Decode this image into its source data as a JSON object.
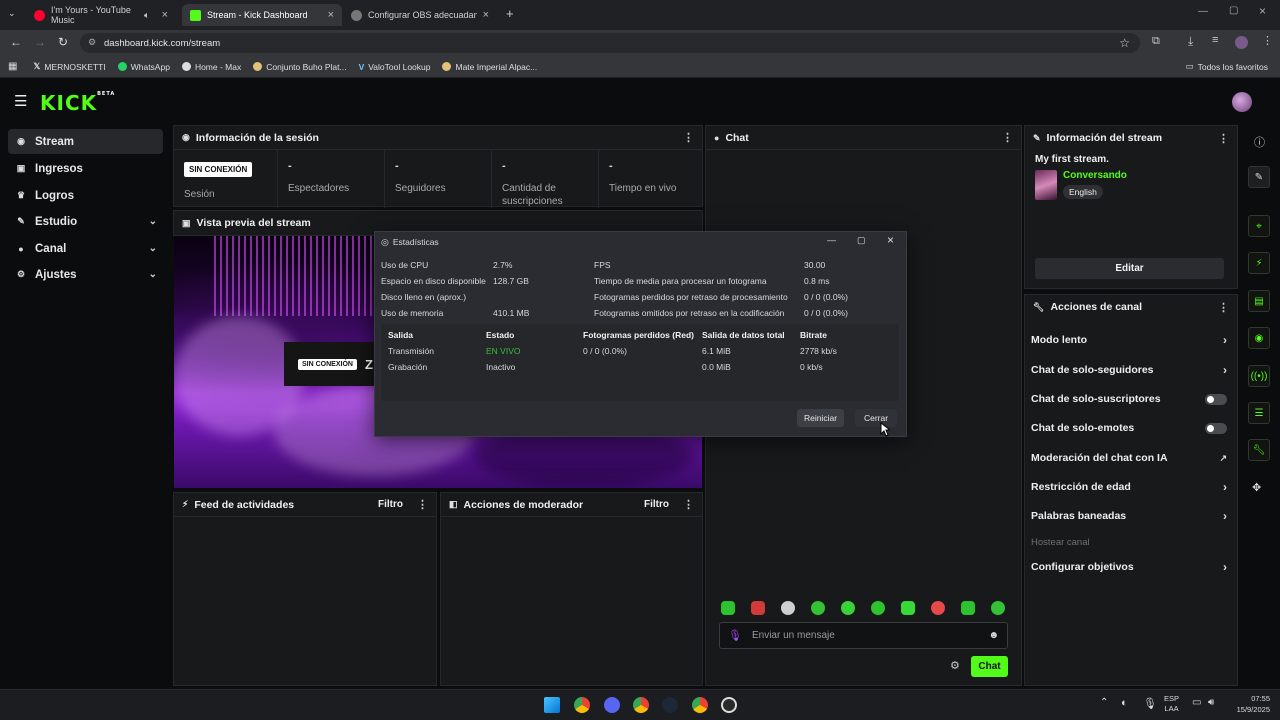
{
  "browser": {
    "tabs": [
      {
        "title": "I'm Yours - YouTube Music",
        "active": false,
        "color": "#ff0033"
      },
      {
        "title": "Stream - Kick Dashboard",
        "active": true,
        "color": "#53fc18"
      },
      {
        "title": "Configurar OBS adecuadament",
        "active": false,
        "color": "#888888"
      }
    ],
    "new_tab_icon": "plus-icon",
    "url": "dashboard.kick.com/stream",
    "bookmarks": [
      "MERNOSKETTI",
      "WhatsApp",
      "Home - Max",
      "Conjunto Buho Plat...",
      "ValoTool Lookup",
      "Mate Imperial Alpac..."
    ],
    "bookmarks_all": "Todos los favoritos"
  },
  "kick": {
    "logo": "KICK",
    "logo_sup": "BETA",
    "accent": "#53fc18"
  },
  "sidebar": {
    "items": [
      {
        "label": "Stream",
        "icon": "broadcast-icon",
        "active": true
      },
      {
        "label": "Ingresos",
        "icon": "wallet-icon"
      },
      {
        "label": "Logros",
        "icon": "trophy-icon"
      },
      {
        "label": "Estudio",
        "icon": "pencil-icon",
        "expandable": true
      },
      {
        "label": "Canal",
        "icon": "user-icon",
        "expandable": true
      },
      {
        "label": "Ajustes",
        "icon": "gear-icon",
        "expandable": true
      }
    ]
  },
  "session": {
    "title": "Información de la sesión",
    "badge": "SIN CONEXIÓN",
    "session_label": "Sesión",
    "stats": [
      {
        "value": "-",
        "label": "Espectadores"
      },
      {
        "value": "-",
        "label": "Seguidores"
      },
      {
        "value": "-",
        "label": "Cantidad de suscripciones"
      },
      {
        "value": "-",
        "label": "Tiempo en vivo"
      }
    ]
  },
  "preview": {
    "title": "Vista previa del stream",
    "badge": "SIN CONEXIÓN",
    "partial_text": "Z"
  },
  "feed": {
    "title": "Feed de actividades",
    "filter": "Filtro"
  },
  "mod": {
    "title": "Acciones de moderador",
    "filter": "Filtro"
  },
  "chat": {
    "title": "Chat",
    "placeholder": "Enviar un mensaje",
    "send": "Chat"
  },
  "stream_info": {
    "title": "Información del stream",
    "stream_title": "My first stream.",
    "category": "Conversando",
    "language": "English",
    "edit": "Editar"
  },
  "channel_actions": {
    "title": "Acciones de canal",
    "items": [
      {
        "label": "Modo lento",
        "kind": "chevron"
      },
      {
        "label": "Chat de solo-seguidores",
        "kind": "chevron"
      },
      {
        "label": "Chat de solo-suscriptores",
        "kind": "toggle",
        "on": false
      },
      {
        "label": "Chat de solo-emotes",
        "kind": "toggle",
        "on": false
      },
      {
        "label": "Moderación del chat con IA",
        "kind": "external"
      },
      {
        "label": "Restricción de edad",
        "kind": "chevron"
      },
      {
        "label": "Palabras baneadas",
        "kind": "chevron"
      },
      {
        "label": "Hostear canal",
        "kind": "disabled"
      },
      {
        "label": "Configurar objetivos",
        "kind": "chevron"
      }
    ]
  },
  "stats_dialog": {
    "title": "Estadísticas",
    "left": [
      {
        "k": "Uso de CPU",
        "v": "2.7%"
      },
      {
        "k": "Espacio en disco disponible",
        "v": "128.7 GB"
      },
      {
        "k": "Disco lleno en (aprox.)",
        "v": ""
      },
      {
        "k": "Uso de memoria",
        "v": "410.1 MB"
      }
    ],
    "right": [
      {
        "k": "FPS",
        "v": "30.00"
      },
      {
        "k": "Tiempo de media para procesar un fotograma",
        "v": "0.8 ms"
      },
      {
        "k": "Fotogramas perdidos por retraso de procesamiento",
        "v": "0 / 0 (0.0%)"
      },
      {
        "k": "Fotogramas omitidos por retraso en la codificación",
        "v": "0 / 0 (0.0%)"
      }
    ],
    "headers": [
      "Salida",
      "Estado",
      "Fotogramas perdidos (Red)",
      "Salida de datos total",
      "Bitrate"
    ],
    "rows": [
      [
        "Transmisión",
        "EN VIVO",
        "0 / 0 (0.0%)",
        "6.1 MiB",
        "2778 kb/s"
      ],
      [
        "Grabación",
        "Inactivo",
        "",
        "0.0 MiB",
        "0 kb/s"
      ]
    ],
    "live_color": "#3dbb3d",
    "reset": "Reiniciar",
    "close": "Cerrar"
  },
  "taskbar": {
    "lang": "ESP",
    "lang2": "LAA",
    "time": "07:55",
    "date": "15/9/2025"
  }
}
